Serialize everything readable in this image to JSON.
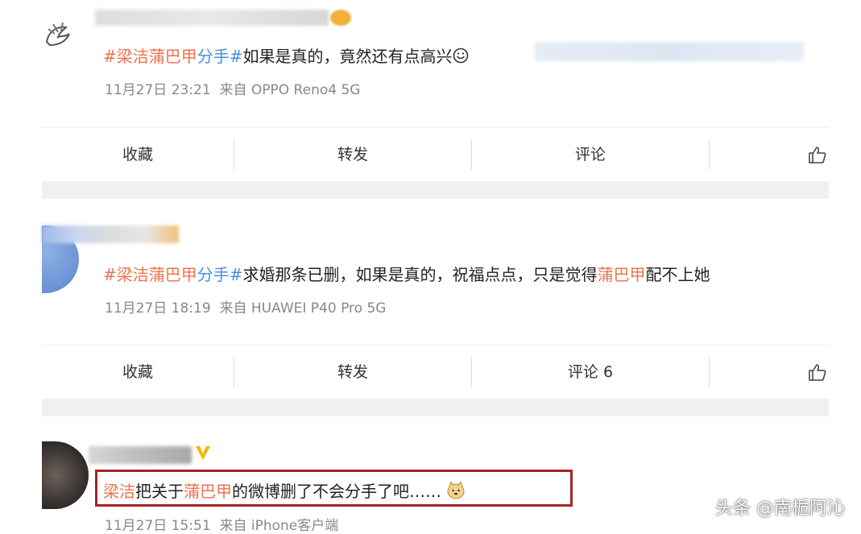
{
  "posts": [
    {
      "topic_a": "#梁洁蒲巴甲",
      "topic_b": "分手#",
      "body": "如果是真的，竟然还有点高兴",
      "time": "11月27日 23:21",
      "source": "来自 OPPO Reno4 5G"
    },
    {
      "topic_a": "#梁洁蒲巴甲",
      "topic_b": "分手#",
      "body_before": "求婚那条已删，如果是真的，祝福点点，只是觉得",
      "body_mention": "蒲巴甲",
      "body_after": "配不上她",
      "time": "11月27日 18:19",
      "source": "来自 HUAWEI P40 Pro 5G"
    },
    {
      "mention1": "梁洁",
      "middle": "把关于",
      "mention2": "蒲巴甲",
      "rest": "的微博删了不会分手了吧……",
      "time": "11月27日 15:51",
      "source": "来自 iPhone客户端",
      "verified_badge": "V"
    }
  ],
  "actions": {
    "row1": {
      "collect": "收藏",
      "repost": "转发",
      "comment": "评论"
    },
    "row2": {
      "collect": "收藏",
      "repost": "转发",
      "comment": "评论 6"
    }
  },
  "watermark": "头条 @南栀阿沁",
  "colors": {
    "topic": "#eb7350",
    "link_blue": "#4a90d9",
    "highlight_border": "#a52328",
    "verified": "#f5b800"
  },
  "icons": [
    "thumbs-up-icon",
    "grin-emoji-icon",
    "doge-emoji-icon",
    "verified-v-icon"
  ]
}
